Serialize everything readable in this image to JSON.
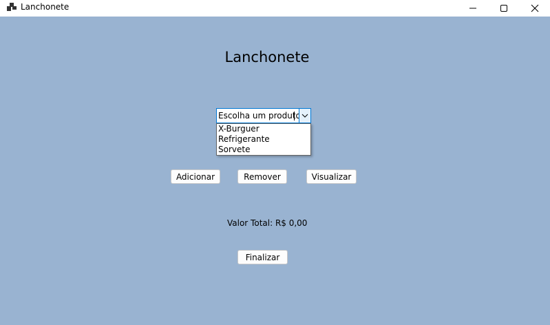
{
  "window": {
    "title": "Lanchonete",
    "icons": {
      "app": "app-icon",
      "minimize": "minimize-icon",
      "maximize": "maximize-icon",
      "close": "close-icon"
    }
  },
  "colors": {
    "client_background": "#99b3d1",
    "accent": "#0078d4"
  },
  "form": {
    "heading": "Lanchonete",
    "product_combo": {
      "value": "Escolha um produto",
      "options": [
        "X-Burguer",
        "Refrigerante",
        "Sorvete"
      ],
      "expanded": true
    },
    "buttons": {
      "add": "Adicionar",
      "remove": "Remover",
      "view": "Visualizar",
      "finish": "Finalizar"
    },
    "total_label": "Valor Total: R$ 0,00"
  }
}
